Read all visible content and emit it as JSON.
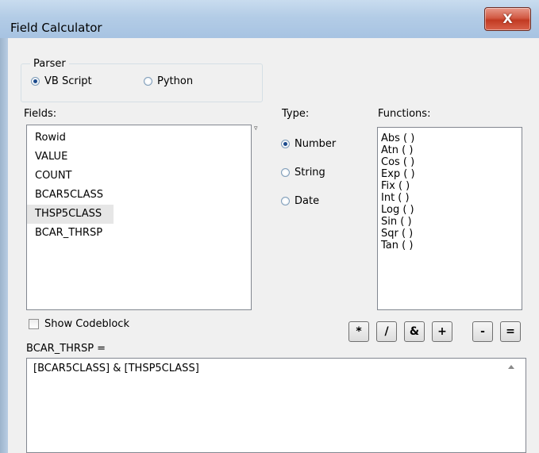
{
  "window": {
    "title": "Field Calculator",
    "close_label": "X"
  },
  "parser": {
    "group_label": "Parser",
    "options": [
      {
        "label": "VB Script",
        "checked": true
      },
      {
        "label": "Python",
        "checked": false
      }
    ]
  },
  "fields": {
    "label": "Fields:",
    "items": [
      "Rowid",
      "VALUE",
      "COUNT",
      "BCAR5CLASS",
      "THSP5CLASS",
      "BCAR_THRSP"
    ],
    "selected": "THSP5CLASS"
  },
  "type": {
    "label": "Type:",
    "options": [
      {
        "label": "Number",
        "checked": true
      },
      {
        "label": "String",
        "checked": false
      },
      {
        "label": "Date",
        "checked": false
      }
    ]
  },
  "functions": {
    "label": "Functions:",
    "items": [
      "Abs ( )",
      "Atn ( )",
      "Cos ( )",
      "Exp ( )",
      "Fix ( )",
      "Int ( )",
      "Log ( )",
      "Sin ( )",
      "Sqr ( )",
      "Tan ( )"
    ]
  },
  "show_codeblock": {
    "label": "Show Codeblock",
    "checked": false
  },
  "operators": [
    "*",
    "/",
    "&",
    "+",
    "-",
    "="
  ],
  "expression": {
    "target_label": "BCAR_THRSP =",
    "value": "[BCAR5CLASS] & [THSP5CLASS]"
  }
}
